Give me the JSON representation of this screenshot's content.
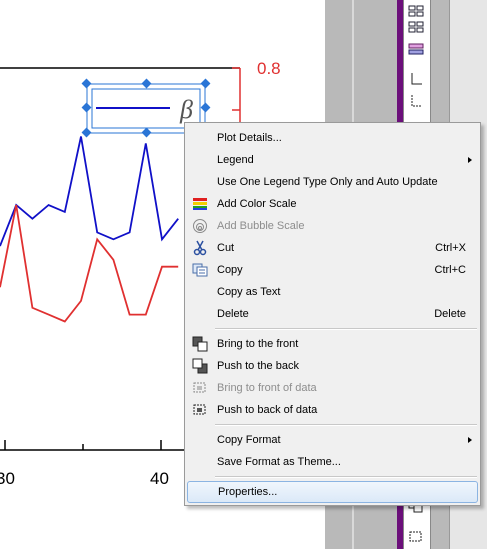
{
  "graph": {
    "y_tick_label": "0.8",
    "x_tick_labels": [
      "30",
      "40"
    ],
    "legend_symbol": "β",
    "colors": {
      "series_a": "#1010c8",
      "series_b": "#e03030",
      "axis": "#000000",
      "right_axis": "#e03030",
      "selection": "#2a75d6"
    },
    "chart_data": {
      "type": "line",
      "x_ticks": [
        30,
        40
      ],
      "y_ticks": [
        0.8
      ],
      "series": [
        {
          "values": [
            0.54,
            0.6,
            0.58,
            0.6,
            0.59,
            0.7,
            0.56,
            0.55,
            0.56,
            0.69,
            0.55,
            0.58
          ]
        },
        {
          "values": [
            0.48,
            0.6,
            0.45,
            0.44,
            0.43,
            0.46,
            0.55,
            0.52,
            0.44,
            0.44,
            0.51,
            0.51
          ]
        }
      ]
    }
  },
  "context_menu": {
    "items": [
      {
        "label": "Plot Details...",
        "shortcut": "",
        "submenu": false,
        "disabled": false,
        "icon": ""
      },
      {
        "label": "Legend",
        "shortcut": "",
        "submenu": true,
        "disabled": false,
        "icon": ""
      },
      {
        "label": "Use One Legend Type Only and Auto Update",
        "shortcut": "",
        "submenu": false,
        "disabled": false,
        "icon": ""
      },
      {
        "label": "Add Color Scale",
        "shortcut": "",
        "submenu": false,
        "disabled": false,
        "icon": "color-scale-icon"
      },
      {
        "label": "Add Bubble Scale",
        "shortcut": "",
        "submenu": false,
        "disabled": true,
        "icon": "bubble-scale-icon"
      },
      {
        "label": "Cut",
        "shortcut": "Ctrl+X",
        "submenu": false,
        "disabled": false,
        "icon": "scissors-icon"
      },
      {
        "label": "Copy",
        "shortcut": "Ctrl+C",
        "submenu": false,
        "disabled": false,
        "icon": "copy-icon"
      },
      {
        "label": "Copy as Text",
        "shortcut": "",
        "submenu": false,
        "disabled": false,
        "icon": ""
      },
      {
        "label": "Delete",
        "shortcut": "Delete",
        "submenu": false,
        "disabled": false,
        "icon": ""
      },
      {
        "label": "Bring to the front",
        "shortcut": "",
        "submenu": false,
        "disabled": false,
        "icon": "bring-front-icon"
      },
      {
        "label": "Push to the back",
        "shortcut": "",
        "submenu": false,
        "disabled": false,
        "icon": "push-back-icon"
      },
      {
        "label": "Bring to front of data",
        "shortcut": "",
        "submenu": false,
        "disabled": true,
        "icon": "bring-front-data-icon"
      },
      {
        "label": "Push to back of data",
        "shortcut": "",
        "submenu": false,
        "disabled": false,
        "icon": "push-back-data-icon"
      },
      {
        "label": "Copy Format",
        "shortcut": "",
        "submenu": true,
        "disabled": false,
        "icon": ""
      },
      {
        "label": "Save Format as Theme...",
        "shortcut": "",
        "submenu": false,
        "disabled": false,
        "icon": ""
      },
      {
        "label": "Properties...",
        "shortcut": "",
        "submenu": false,
        "disabled": false,
        "icon": "",
        "highlighted": true
      }
    ]
  }
}
